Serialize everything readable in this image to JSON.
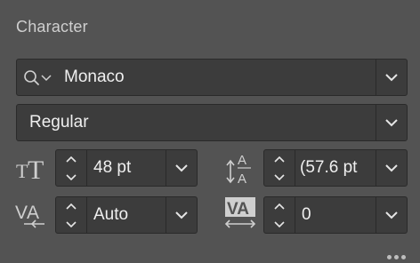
{
  "panel": {
    "title": "Character"
  },
  "font_family": {
    "value": "Monaco"
  },
  "font_style": {
    "value": "Regular"
  },
  "font_size": {
    "value": "48 pt"
  },
  "leading": {
    "value": "(57.6 pt"
  },
  "kerning": {
    "value": "Auto"
  },
  "tracking": {
    "value": "0"
  },
  "icons": {
    "search": "search-icon",
    "chevron": "chevron-down-icon",
    "font_size": "font-size-icon",
    "leading": "leading-icon",
    "kerning": "kerning-icon",
    "tracking": "tracking-icon",
    "more": "more-icon"
  },
  "colors": {
    "background": "#535353",
    "field": "#3c3c3c",
    "text": "#efefef"
  }
}
